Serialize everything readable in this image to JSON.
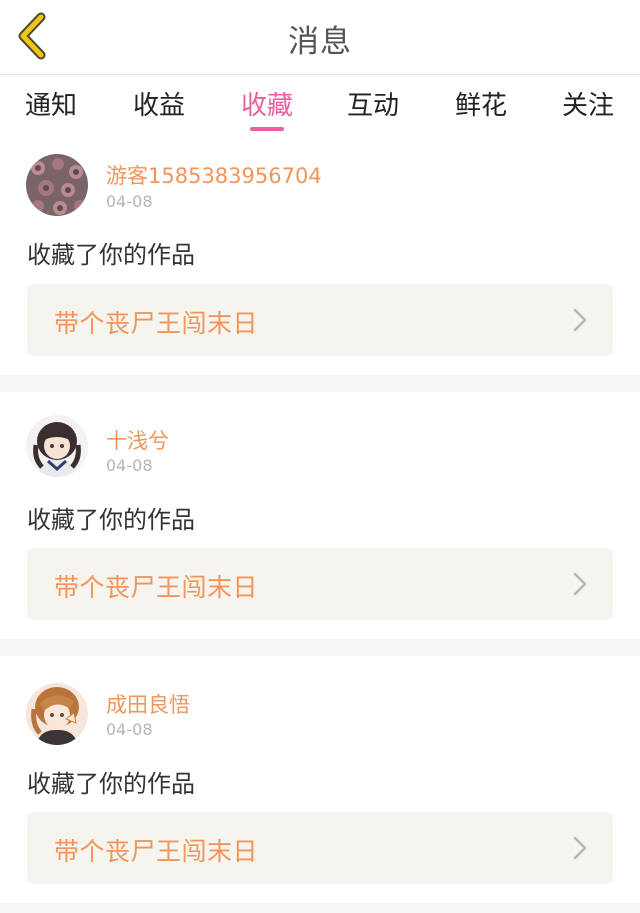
{
  "header": {
    "title": "消息",
    "back_icon": "chevron-left-icon"
  },
  "tabs": [
    {
      "label": "通知",
      "active": false
    },
    {
      "label": "收益",
      "active": false
    },
    {
      "label": "收藏",
      "active": true
    },
    {
      "label": "互动",
      "active": false
    },
    {
      "label": "鲜花",
      "active": false
    },
    {
      "label": "关注",
      "active": false
    }
  ],
  "colors": {
    "accent": "#ea5fa0",
    "username": "#f2955b",
    "back_arrow": "#f0c419",
    "work_box_bg": "#f5f4ee"
  },
  "notifications": [
    {
      "username": "游客1585383956704",
      "date": "04-08",
      "action": "收藏了你的作品",
      "work_title": "带个丧尸王闯末日"
    },
    {
      "username": "十浅兮",
      "date": "04-08",
      "action": "收藏了你的作品",
      "work_title": "带个丧尸王闯末日"
    },
    {
      "username": "成田良悟",
      "date": "04-08",
      "action": "收藏了你的作品",
      "work_title": "带个丧尸王闯末日"
    }
  ]
}
